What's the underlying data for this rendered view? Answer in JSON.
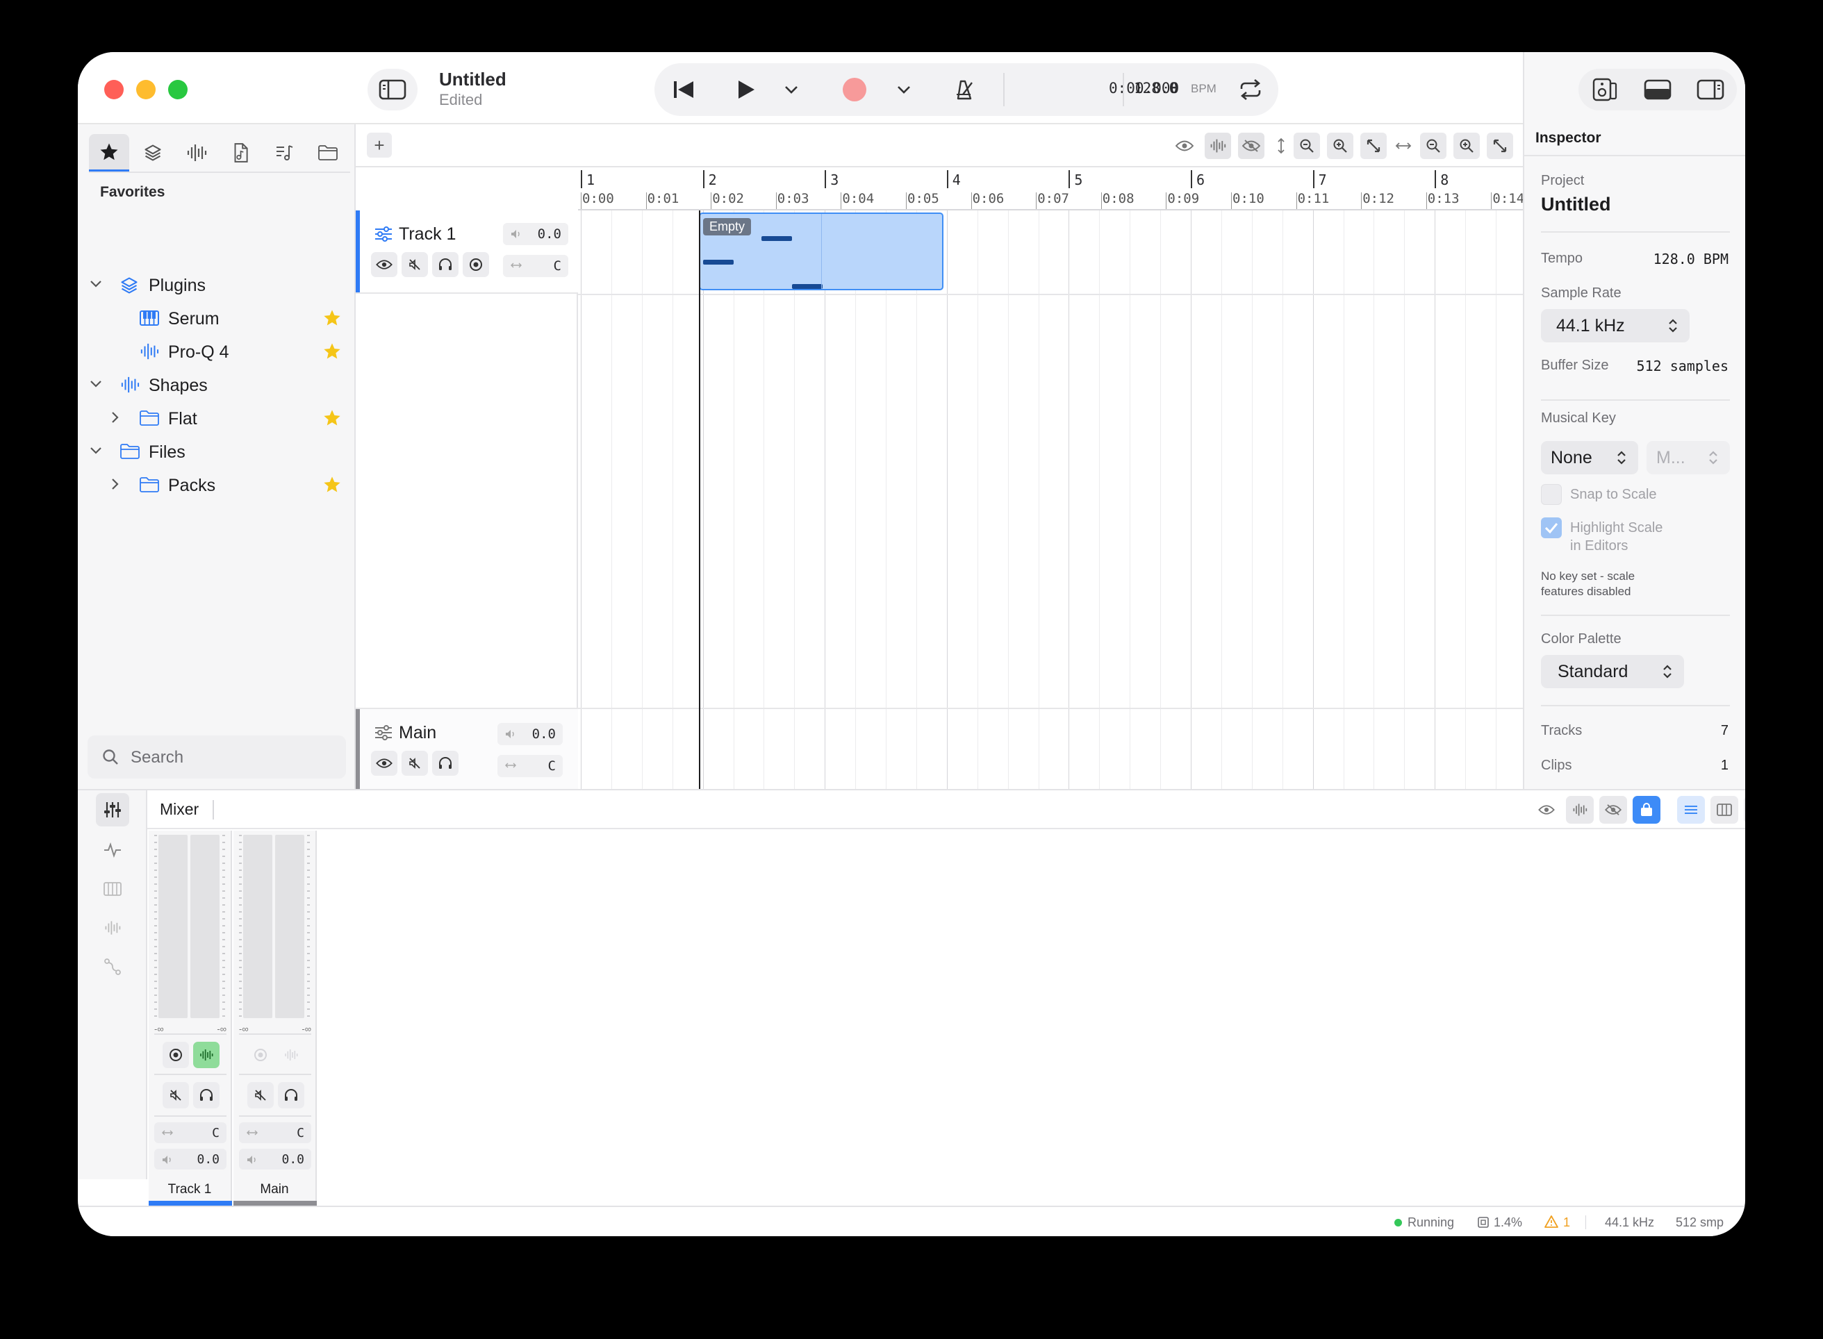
{
  "window": {
    "title": "Untitled",
    "subtitle": "Edited",
    "traffic_lights": {
      "close": "#ff5f57",
      "minimize": "#febc2e",
      "zoom": "#28c840"
    }
  },
  "transport": {
    "time": "0:00.000",
    "bpm_value": "128.0",
    "bpm_unit": "BPM",
    "record_color": "#f79a9a",
    "icons": [
      "sidebar-icon",
      "skip-back-icon",
      "play-icon",
      "chevron-down-icon",
      "record-icon",
      "chevron-down-icon",
      "metronome-icon",
      "loop-icon"
    ]
  },
  "sidebar": {
    "tabs": [
      "star-icon",
      "layers-icon",
      "waveform-icon",
      "file-audio-icon",
      "music-list-icon",
      "folder-icon"
    ],
    "section_label": "Favorites",
    "tree": [
      {
        "label": "Plugins",
        "icon": "layers-icon",
        "level": 0,
        "expanded": true,
        "favorite": false
      },
      {
        "label": "Serum",
        "icon": "piano-icon",
        "level": 1,
        "favorite": true
      },
      {
        "label": "Pro-Q 4",
        "icon": "waveform-icon",
        "level": 1,
        "favorite": true
      },
      {
        "label": "Shapes",
        "icon": "waveform-icon",
        "level": 0,
        "expanded": true,
        "favorite": false
      },
      {
        "label": "Flat",
        "icon": "folder-icon",
        "level": 1,
        "expanded": false,
        "favorite": true
      },
      {
        "label": "Files",
        "icon": "folder-icon",
        "level": 0,
        "expanded": true,
        "favorite": false
      },
      {
        "label": "Packs",
        "icon": "folder-icon",
        "level": 1,
        "expanded": false,
        "favorite": true
      }
    ],
    "search_placeholder": "Search",
    "star_color": "#f5c518",
    "accent": "#2f7bf5"
  },
  "arrangement": {
    "bars": [
      "1",
      "2",
      "3",
      "4",
      "5",
      "6",
      "7",
      "8"
    ],
    "seconds": [
      "0:00",
      "0:01",
      "0:02",
      "0:03",
      "0:04",
      "0:05",
      "0:06",
      "0:07",
      "0:08",
      "0:09",
      "0:10",
      "0:11",
      "0:12",
      "0:13",
      "0:14"
    ],
    "tracks": [
      {
        "name": "Track 1",
        "volume": "0.0",
        "pan": "C",
        "accent": "#2f7bf5"
      },
      {
        "name": "Main",
        "volume": "0.0",
        "pan": "C",
        "accent": "#8e8e93"
      }
    ],
    "clip": {
      "label": "Empty",
      "fill": "#b9d6fb",
      "border": "#3f8ef5",
      "note_color": "#174a94"
    }
  },
  "inspector": {
    "title": "Inspector",
    "project_label": "Project",
    "project_name": "Untitled",
    "tempo_label": "Tempo",
    "tempo_value": "128.0 BPM",
    "sample_rate_label": "Sample Rate",
    "sample_rate_value": "44.1 kHz",
    "buffer_label": "Buffer Size",
    "buffer_value": "512 samples",
    "key_label": "Musical Key",
    "key_value": "None",
    "mode_value": "M...",
    "snap_label": "Snap to Scale",
    "highlight_label_1": "Highlight Scale",
    "highlight_label_2": "in Editors",
    "note_1": "No key set - scale",
    "note_2": "features disabled",
    "palette_label": "Color Palette",
    "palette_value": "Standard",
    "tracks_label": "Tracks",
    "tracks_value": "7",
    "clips_label": "Clips",
    "clips_value": "1"
  },
  "mixer": {
    "title": "Mixer",
    "strips": [
      {
        "name": "Track 1",
        "pan": "C",
        "volume": "0.0",
        "left_db": "-∞",
        "right_db": "-∞",
        "accent": "#2f7bf5"
      },
      {
        "name": "Main",
        "pan": "C",
        "volume": "0.0",
        "left_db": "-∞",
        "right_db": "-∞",
        "accent": "#8e8e93"
      }
    ],
    "input_active_color": "#8fdc9a"
  },
  "status": {
    "state": "Running",
    "state_color": "#34c759",
    "cpu": "1.4%",
    "warnings": "1",
    "warning_color": "#f0a020",
    "sample_rate": "44.1 kHz",
    "buffer": "512 smp"
  }
}
